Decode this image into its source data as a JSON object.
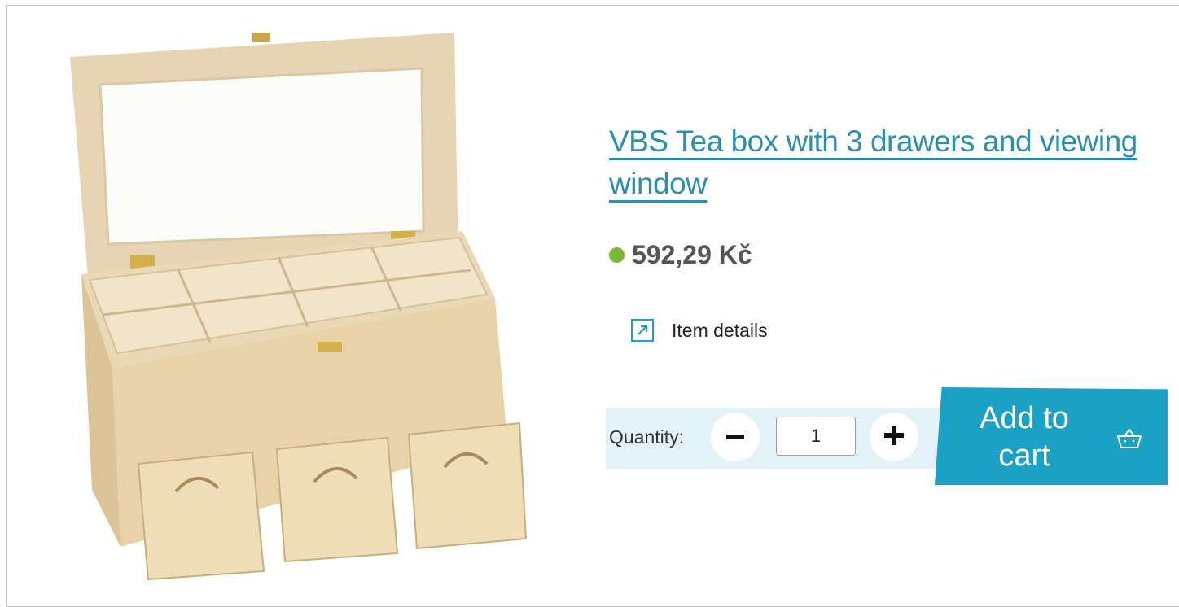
{
  "product": {
    "title": "VBS Tea box with 3 drawers and viewing window",
    "price": "592,29 Kč",
    "details_label": "Item details"
  },
  "quantity": {
    "label": "Quantity:",
    "value": "1"
  },
  "cart": {
    "label": "Add to cart"
  },
  "colors": {
    "accent": "#1ba0c6",
    "title": "#2b8fae",
    "stock": "#7ab936",
    "qty_bg": "#e3f2f8"
  },
  "icons": [
    "external-link-icon",
    "minus-icon",
    "plus-icon",
    "basket-icon",
    "product-image"
  ]
}
